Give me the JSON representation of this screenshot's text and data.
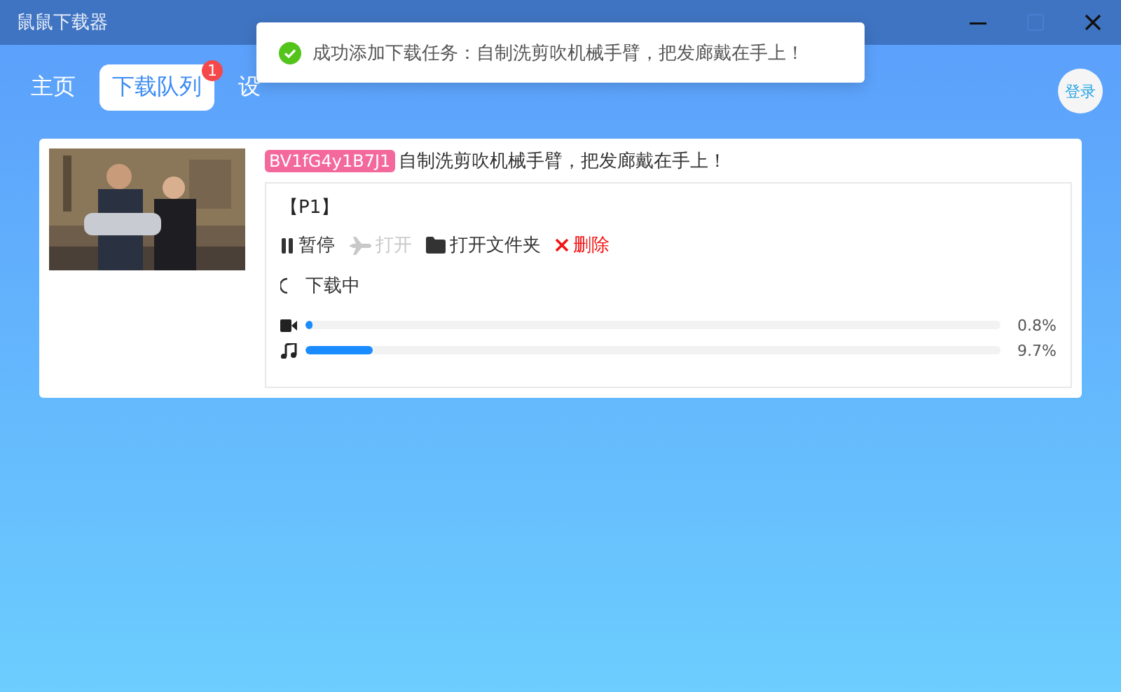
{
  "window": {
    "title": "鼠鼠下载器"
  },
  "tabs": [
    {
      "label": "主页",
      "selected": false
    },
    {
      "label": "下载队列",
      "selected": true,
      "badge": "1"
    },
    {
      "label": "设",
      "selected": false
    }
  ],
  "login_button": "登录",
  "toast": {
    "kind": "success",
    "message": "成功添加下载任务：自制洗剪吹机械手臂，把发廊戴在手上！"
  },
  "task": {
    "bvid": "BV1fG4y1B7J1",
    "title": "自制洗剪吹机械手臂，把发廊戴在手上！",
    "part": "【P1】",
    "actions": [
      {
        "kind": "pause",
        "label": "暂停",
        "disabled": false
      },
      {
        "kind": "open",
        "label": "打开",
        "disabled": true
      },
      {
        "kind": "folder",
        "label": "打开文件夹",
        "disabled": false
      },
      {
        "kind": "delete",
        "label": "删除",
        "disabled": false
      }
    ],
    "status": "下载中",
    "progress": [
      {
        "kind": "video",
        "level": 0.008,
        "reading": "0.8%"
      },
      {
        "kind": "audio",
        "level": 0.097,
        "reading": "9.7%"
      }
    ]
  }
}
